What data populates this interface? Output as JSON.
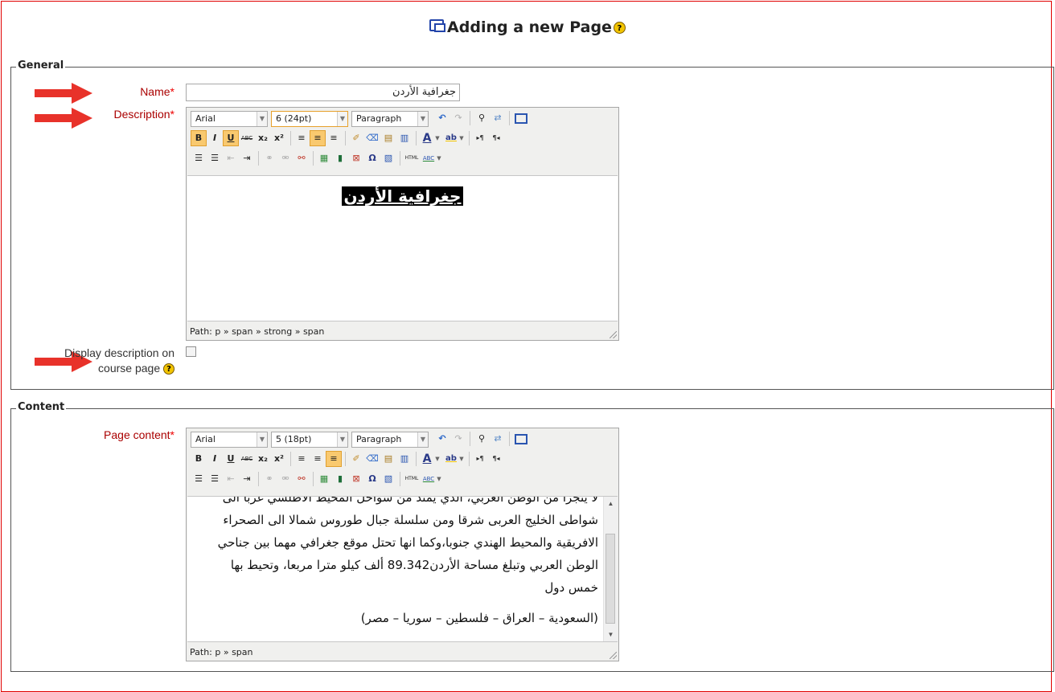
{
  "page": {
    "title": "Adding a new Page",
    "help_glyph": "?"
  },
  "general": {
    "legend": "General",
    "name_label": "Name",
    "name_value": "جغرافية الأردن",
    "description_label": "Description",
    "required_mark": "*",
    "display_label_line1": "Display description on",
    "display_label_line2": "course page",
    "display_checked": false,
    "editor": {
      "font": "Arial",
      "size": "6 (24pt)",
      "format": "Paragraph",
      "content_heading": "جغرافية الأردن",
      "path": "Path: p » span » strong » span"
    }
  },
  "content": {
    "legend": "Content",
    "page_content_label": "Page content",
    "editor": {
      "font": "Arial",
      "size": "5 (18pt)",
      "format": "Paragraph",
      "lines": [
        "لا يتجزأ من الوطن العربي، الذي يمتد من سواحل المحيط الاطلسي غربا الى",
        "شواطى الخليج العربى شرقا ومن سلسلة جبال طوروس شمالا الى الصحراء",
        "الافريقية والمحيط الهندي جنوبا،وكما انها تحتل موقع جغرافي مهما بين جناحي",
        "الوطن العربي  وتبلغ مساحة الأردن89.342 ألف كيلو مترا مربعا، وتحيط بها",
        "خمس دول",
        "(السعودية – العراق – فلسطين – سوريا – مصر)"
      ],
      "path": "Path: p » span"
    }
  },
  "toolbar": {
    "bold": "B",
    "italic": "I",
    "underline": "U",
    "strike": "ABC",
    "sub": "x₂",
    "sup": "x²",
    "text_color": "A",
    "highlight": "ab",
    "ltr": "▸¶",
    "rtl": "¶◂",
    "omega": "Ω",
    "html": "HTML",
    "spell": "ABC"
  },
  "colors": {
    "frame": "#e00000",
    "label": "#aa0000",
    "arrow": "#e8322a",
    "active_button": "#f9c96f"
  }
}
